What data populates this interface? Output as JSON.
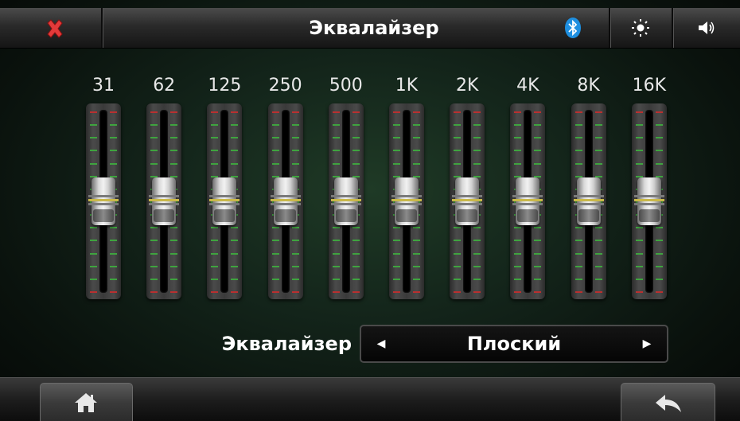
{
  "header": {
    "title": "Эквалайзер",
    "close_icon": "close-icon",
    "bluetooth_icon": "bluetooth-icon",
    "brightness_icon": "sun-icon",
    "volume_icon": "speaker-icon"
  },
  "equalizer": {
    "bands": [
      {
        "label": "31",
        "level": 0
      },
      {
        "label": "62",
        "level": 0
      },
      {
        "label": "125",
        "level": 0
      },
      {
        "label": "250",
        "level": 0
      },
      {
        "label": "500",
        "level": 0
      },
      {
        "label": "1K",
        "level": 0
      },
      {
        "label": "2K",
        "level": 0
      },
      {
        "label": "4K",
        "level": 0
      },
      {
        "label": "8K",
        "level": 0
      },
      {
        "label": "16K",
        "level": 0
      }
    ]
  },
  "preset": {
    "label": "Эквалайзер",
    "value": "Плоский",
    "prev_symbol": "◀",
    "next_symbol": "▶"
  },
  "footer": {
    "home_icon": "home-icon",
    "back_icon": "back-icon"
  },
  "colors": {
    "tick_green": "#3fa33f",
    "tick_red": "#b83030",
    "close_red": "#e03030",
    "bluetooth_blue": "#1e8fe0"
  }
}
